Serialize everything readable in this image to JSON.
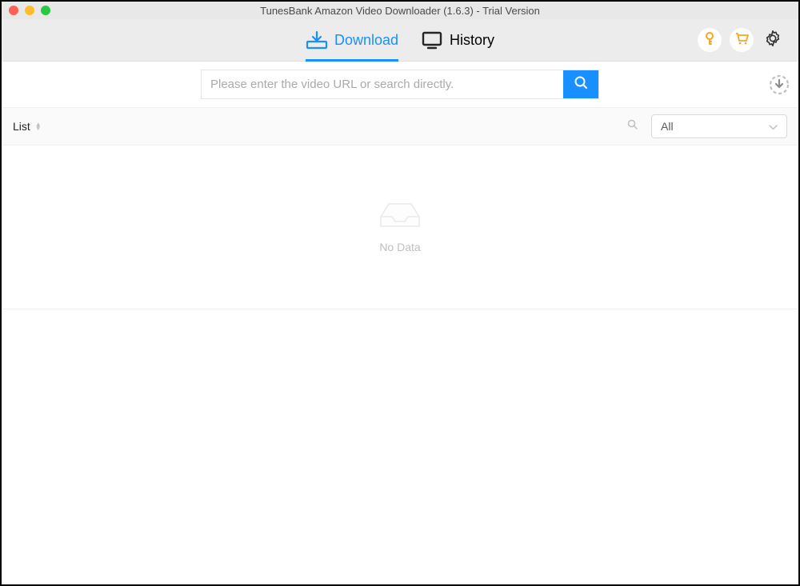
{
  "window": {
    "title": "TunesBank Amazon Video Downloader (1.6.3) - Trial Version"
  },
  "tabs": {
    "download": "Download",
    "history": "History"
  },
  "search": {
    "placeholder": "Please enter the video URL or search directly."
  },
  "list": {
    "label": "List",
    "filter_selected": "All"
  },
  "empty": {
    "message": "No Data"
  }
}
